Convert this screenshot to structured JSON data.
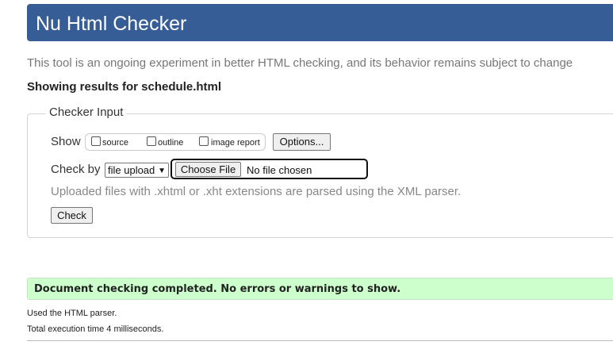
{
  "header": {
    "title": "Nu Html Checker"
  },
  "subtitle": "This tool is an ongoing experiment in better HTML checking, and its behavior remains subject to change",
  "results_for": "Showing results for schedule.html",
  "checker_input": {
    "legend": "Checker Input",
    "show_label": "Show",
    "show_options": [
      {
        "label": "source",
        "checked": false
      },
      {
        "label": "outline",
        "checked": false
      },
      {
        "label": "image report",
        "checked": false
      }
    ],
    "options_button": "Options...",
    "check_by_label": "Check by",
    "check_by_selected": "file upload",
    "choose_file_button": "Choose File",
    "file_status": "No file chosen",
    "upload_note": "Uploaded files with .xhtml or .xht extensions are parsed using the XML parser.",
    "check_button": "Check"
  },
  "result": {
    "message": "Document checking completed. No errors or warnings to show."
  },
  "footer": {
    "parser_line": "Used the HTML parser.",
    "time_line": "Total execution time 4 milliseconds."
  },
  "colors": {
    "header_bg": "#365d95",
    "success_bg": "#ccffcc"
  }
}
